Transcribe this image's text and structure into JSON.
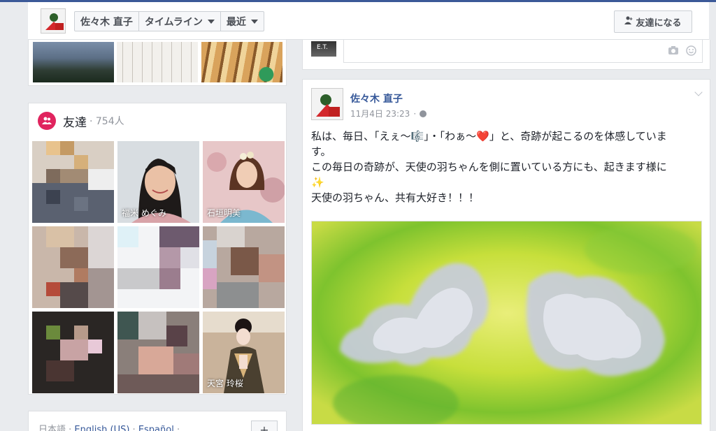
{
  "header": {
    "profile_name": "佐々木 直子",
    "nav_timeline": "タイムライン",
    "nav_recent": "最近",
    "add_friend_label": "友達になる"
  },
  "friends": {
    "title": "友達",
    "count": "· 754人",
    "tiles": [
      {
        "name": ""
      },
      {
        "name": "福米 めぐみ"
      },
      {
        "name": "石垣明美"
      },
      {
        "name": ""
      },
      {
        "name": ""
      },
      {
        "name": ""
      },
      {
        "name": ""
      },
      {
        "name": ""
      },
      {
        "name": "天宮 玲桜"
      }
    ]
  },
  "footer": {
    "lang_current": "日本語",
    "lang_1": "English (US)",
    "lang_2": "Español",
    "plus": "+"
  },
  "composer": {
    "avatar_text": "E.T."
  },
  "post": {
    "author": "佐々木 直子",
    "timestamp": "11月4日 23:23",
    "text_line1": "私は、毎日、「えぇ～🎼」・「わぁ～❤️」と、奇跡が起こるのを体感していま",
    "text_line2": "す。",
    "text_line3": "この毎日の奇跡が、天使の羽ちゃんを側に置いている方にも、起きます様に",
    "text_line4": "✨",
    "text_line5": "天使の羽ちゃん、共有大好き！！！"
  },
  "colors": {
    "brand": "#3b5998",
    "link": "#365899",
    "friends_icon": "#e0245e",
    "background": "#e9ebee"
  },
  "icons": {
    "add_friend": "person-add-icon",
    "friends": "friends-icon",
    "camera": "camera-icon",
    "emoji": "smiley-icon",
    "privacy": "globe-icon",
    "menu": "chevron-down-icon"
  }
}
